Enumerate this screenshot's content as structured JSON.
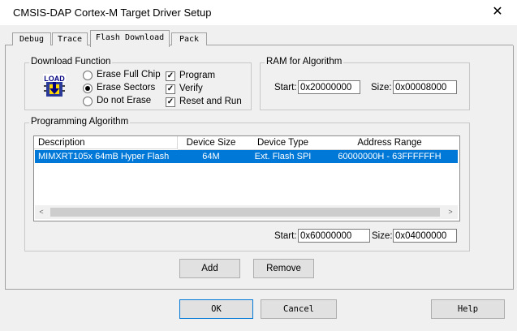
{
  "window": {
    "title": "CMSIS-DAP Cortex-M Target Driver Setup",
    "close_glyph": "✕"
  },
  "tabs": [
    {
      "label": "Debug"
    },
    {
      "label": "Trace"
    },
    {
      "label": "Flash Download"
    },
    {
      "label": "Pack"
    }
  ],
  "download_function": {
    "legend": "Download Function",
    "icon_text": "LOAD",
    "radios": [
      {
        "label": "Erase Full Chip",
        "selected": false
      },
      {
        "label": "Erase Sectors",
        "selected": true
      },
      {
        "label": "Do not Erase",
        "selected": false
      }
    ],
    "checks": [
      {
        "label": "Program",
        "checked": true
      },
      {
        "label": "Verify",
        "checked": true
      },
      {
        "label": "Reset and Run",
        "checked": true
      }
    ]
  },
  "ram": {
    "legend": "RAM for Algorithm",
    "start_label": "Start:",
    "start_value": "0x20000000",
    "size_label": "Size:",
    "size_value": "0x00008000"
  },
  "algorithm": {
    "legend": "Programming Algorithm",
    "columns": [
      "Description",
      "Device Size",
      "Device Type",
      "Address Range"
    ],
    "rows": [
      {
        "description": "MIMXRT105x 64mB Hyper Flash",
        "size": "64M",
        "type": "Ext. Flash SPI",
        "range": "60000000H - 63FFFFFFH"
      }
    ],
    "start_label": "Start:",
    "start_value": "0x60000000",
    "size_label": "Size:",
    "size_value": "0x04000000",
    "add_label": "Add",
    "remove_label": "Remove"
  },
  "footer": {
    "ok": "OK",
    "cancel": "Cancel",
    "help": "Help"
  }
}
